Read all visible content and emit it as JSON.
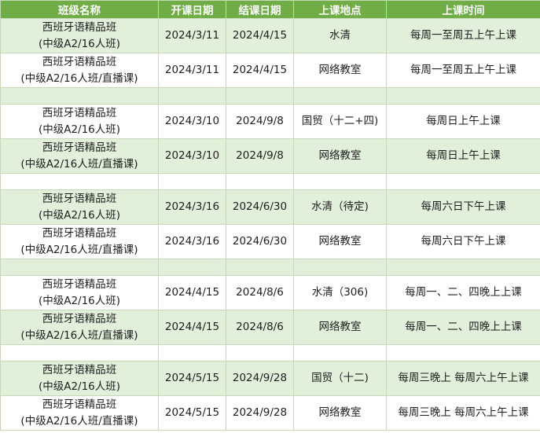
{
  "headers": [
    "班级名称",
    "开课日期",
    "结课日期",
    "上课地点",
    "上课时间"
  ],
  "rows": [
    {
      "type": "data",
      "shade": "green",
      "name1": "西班牙语精品班",
      "name2": "(中级A2/16人班)",
      "start": "2024/3/11",
      "end": "2024/4/15",
      "place": "水清",
      "time": "每周一至周五上午上课"
    },
    {
      "type": "data",
      "shade": "white",
      "name1": "西班牙语精品班",
      "name2": "(中级A2/16人班/直播课)",
      "start": "2024/3/11",
      "end": "2024/4/15",
      "place": "网络教室",
      "time": "每周一至周五上午上课"
    },
    {
      "type": "spacer",
      "shade": "green"
    },
    {
      "type": "data",
      "shade": "white",
      "name1": "西班牙语精品班",
      "name2": "(中级A2/16人班)",
      "start": "2024/3/10",
      "end": "2024/9/8",
      "place": "国贸（十二+四)",
      "time": "每周日上午上课"
    },
    {
      "type": "data",
      "shade": "green",
      "name1": "西班牙语精品班",
      "name2": "(中级A2/16人班/直播课)",
      "start": "2024/3/10",
      "end": "2024/9/8",
      "place": "网络教室",
      "time": "每周日上午上课"
    },
    {
      "type": "spacer",
      "shade": "white"
    },
    {
      "type": "data",
      "shade": "green",
      "name1": "西班牙语精品班",
      "name2": "(中级A2/16人班)",
      "start": "2024/3/16",
      "end": "2024/6/30",
      "place": "水清（待定)",
      "time": "每周六日下午上课"
    },
    {
      "type": "data",
      "shade": "white",
      "name1": "西班牙语精品班",
      "name2": "(中级A2/16人班/直播课)",
      "start": "2024/3/16",
      "end": "2024/6/30",
      "place": "网络教室",
      "time": "每周六日下午上课"
    },
    {
      "type": "spacer",
      "shade": "green"
    },
    {
      "type": "data",
      "shade": "white",
      "name1": "西班牙语精品班",
      "name2": "(中级A2/16人班)",
      "start": "2024/4/15",
      "end": "2024/8/6",
      "place": "水清（306)",
      "time": "每周一、二、四晚上上课"
    },
    {
      "type": "data",
      "shade": "green",
      "name1": "西班牙语精品班",
      "name2": "(中级A2/16人班/直播课)",
      "start": "2024/4/15",
      "end": "2024/8/6",
      "place": "网络教室",
      "time": "每周一、二、四晚上上课"
    },
    {
      "type": "spacer",
      "shade": "white"
    },
    {
      "type": "data",
      "shade": "green",
      "name1": "西班牙语精品班",
      "name2": "(中级A2/16人班)",
      "start": "2024/5/15",
      "end": "2024/9/28",
      "place": "国贸（十二)",
      "time": "每周三晚上 每周六上午上课"
    },
    {
      "type": "data",
      "shade": "white",
      "name1": "西班牙语精品班",
      "name2": "(中级A2/16人班/直播课)",
      "start": "2024/5/15",
      "end": "2024/9/28",
      "place": "网络教室",
      "time": "每周三晚上 每周六上午上课"
    }
  ]
}
